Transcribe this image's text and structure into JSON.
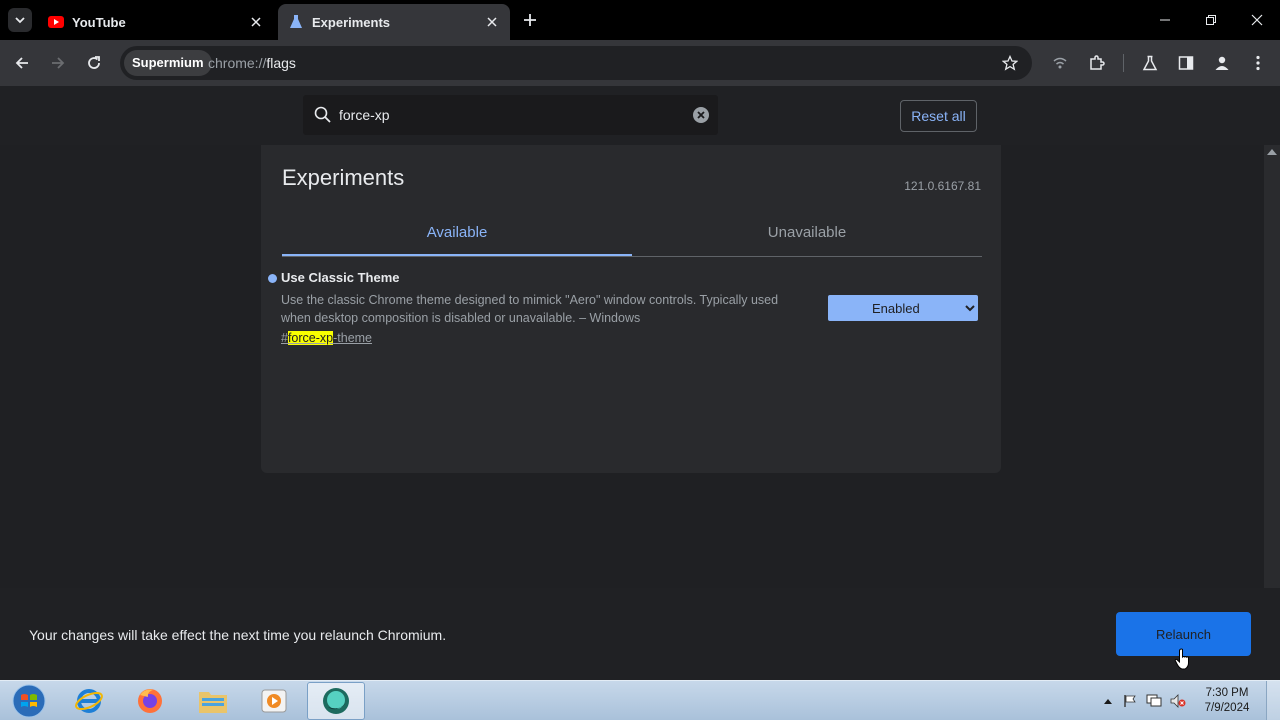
{
  "tabs": [
    {
      "title": "YouTube",
      "favicon": "youtube-icon",
      "active": false
    },
    {
      "title": "Experiments",
      "favicon": "flask-icon",
      "active": true
    }
  ],
  "omnibox": {
    "chip": "Supermium",
    "url_scheme": "chrome://",
    "url_host": "flags"
  },
  "flags": {
    "search_value": "force-xp",
    "reset_label": "Reset all",
    "title": "Experiments",
    "version": "121.0.6167.81",
    "tab_available": "Available",
    "tab_unavailable": "Unavailable",
    "flag": {
      "name": "Use Classic Theme",
      "description": "Use the classic Chrome theme designed to mimick \"Aero\" window controls. Typically used when desktop composition is disabled or unavailable. – Windows",
      "link_prefix": "#",
      "link_highlight": "force-xp",
      "link_suffix": "-theme",
      "selected": "Enabled"
    }
  },
  "relaunch": {
    "message": "Your changes will take effect the next time you relaunch Chromium.",
    "button": "Relaunch"
  },
  "taskbar": {
    "time": "7:30 PM",
    "date": "7/9/2024"
  },
  "colors": {
    "accent": "#8ab4f8",
    "relaunch_button": "#1a73e8",
    "highlight": "#f9ff00"
  }
}
